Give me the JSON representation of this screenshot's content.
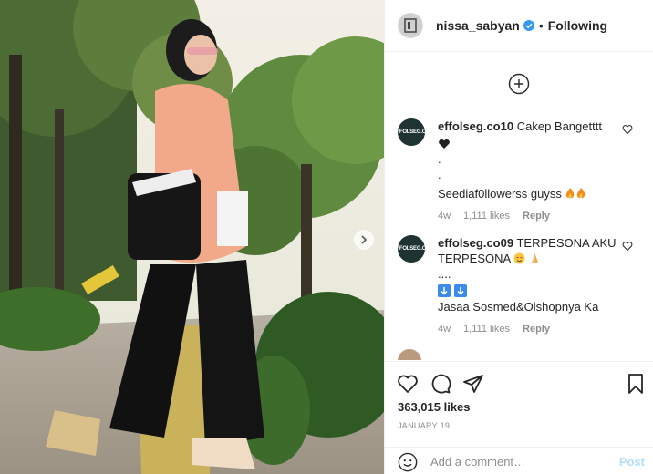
{
  "post": {
    "username": "nissa_sabyan",
    "separator": "•",
    "following_label": "Following",
    "likes_text": "363,015 likes",
    "date_text": "JANUARY 19"
  },
  "comments": [
    {
      "username": "effolseg.co10",
      "avatar_text": "EFFOLSEG.CO",
      "text": "Cakep Bangetttt",
      "extra_lines": [
        ".",
        "."
      ],
      "last_line": "Seediaf0llowerss guyss",
      "age": "4w",
      "likes": "1,111 likes",
      "reply_label": "Reply"
    },
    {
      "username": "effolseg.co09",
      "avatar_text": "EFFOLSEG.CO",
      "text": "TERPESONA AKU TERPESONA",
      "extra_lines": [
        "...."
      ],
      "last_line": "Jasaa Sosmed&Olshopnya Ka",
      "age": "4w",
      "likes": "1,111 likes",
      "reply_label": "Reply"
    }
  ],
  "add_comment": {
    "placeholder": "Add a comment…",
    "post_label": "Post"
  },
  "icons": {
    "verified": "verified-badge-icon",
    "load_more": "plus-circle-icon",
    "like": "heart-icon",
    "comment": "comment-bubble-icon",
    "share": "paper-plane-icon",
    "save": "bookmark-icon",
    "emoji": "smiley-icon",
    "next": "chevron-right-icon"
  },
  "colors": {
    "verified": "#3897f0",
    "post_button": "#b2dffc",
    "meta_text": "#8e8e8e"
  }
}
